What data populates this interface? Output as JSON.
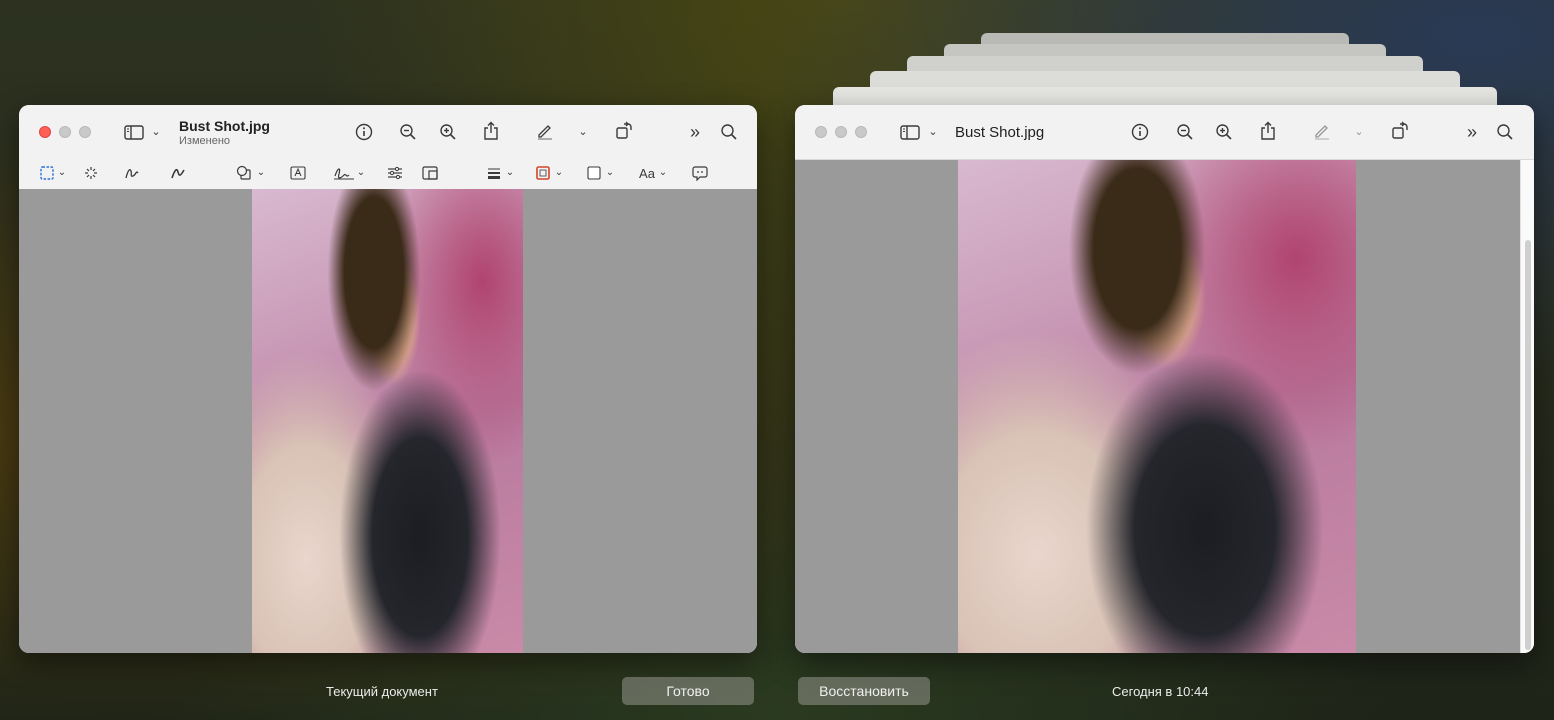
{
  "left_window": {
    "title": "Bust Shot.jpg",
    "subtitle": "Изменено"
  },
  "right_window": {
    "title": "Bust Shot.jpg"
  },
  "icons": {
    "sidebar": "sidebar-icon",
    "info": "info-icon",
    "zoom_out": "zoom-out-icon",
    "zoom_in": "zoom-in-icon",
    "share": "share-icon",
    "markup": "pen-icon",
    "rotate": "rotate-icon",
    "more": "chevron-double-right-icon",
    "search": "search-icon"
  },
  "markup_toolbar": {
    "text_style_label": "Aa"
  },
  "footer": {
    "current_document_label": "Текущий документ",
    "done_button": "Готово",
    "restore_button": "Восстановить",
    "version_time": "Сегодня в 10:44"
  },
  "colors": {
    "close": "#fe5f57",
    "content_bg": "#9a9a9a",
    "toolbar_bg": "#f2f2f2"
  }
}
